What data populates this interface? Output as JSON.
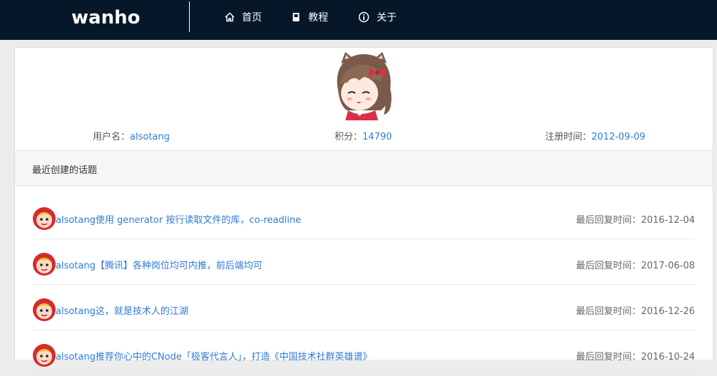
{
  "navbar": {
    "brand": "wanho",
    "items": [
      {
        "label": "首页",
        "icon": "home-icon"
      },
      {
        "label": "教程",
        "icon": "book-icon"
      },
      {
        "label": "关于",
        "icon": "info-icon"
      }
    ]
  },
  "profile": {
    "username_label": "用户名：",
    "username": "alsotang",
    "score_label": "积分：",
    "score": "14790",
    "register_label": "注册时间：",
    "register_date": "2012-09-09"
  },
  "recent": {
    "heading": "最近创建的话题",
    "reply_label": "最后回复时间：",
    "topics": [
      {
        "author": "alsotang",
        "title": "使用 generator 按行读取文件的库，co-readline",
        "time": "2016-12-04"
      },
      {
        "author": "alsotang",
        "title": "【腾讯】各种岗位均可内推，前后端均可",
        "time": "2017-06-08"
      },
      {
        "author": "alsotang",
        "title": "这，就是技术人的江湖",
        "time": "2016-12-26"
      },
      {
        "author": "alsotang",
        "title": "推荐你心中的CNode「极客代言人」，打造《中国技术社群英雄谱》",
        "time": "2016-10-24"
      }
    ]
  },
  "colors": {
    "navbar": "#07172a",
    "link": "#2f7ad6"
  }
}
